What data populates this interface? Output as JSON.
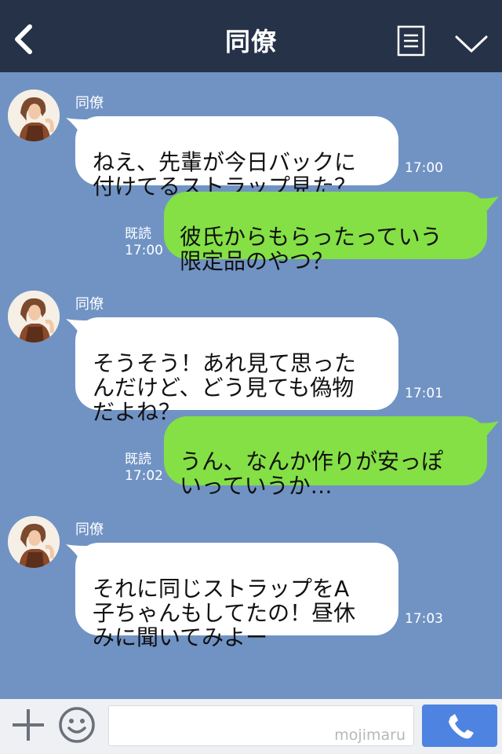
{
  "header": {
    "title": "同僚"
  },
  "messages": [
    {
      "sender": "同僚",
      "text": "ねえ、先輩が今日バックに\n付けてるストラップ見た？",
      "time": "17:00"
    },
    {
      "read": "既読",
      "text": "彼氏からもらったっていう\n限定品のやつ？",
      "time": "17:00"
    },
    {
      "sender": "同僚",
      "text": "そうそう！あれ見て思った\nんだけど、どう見ても偽物\nだよね？",
      "time": "17:01"
    },
    {
      "read": "既読",
      "text": "うん、なんか作りが安っぽ\nいっていうか…",
      "time": "17:02"
    },
    {
      "sender": "同僚",
      "text": "それに同じストラップをA\n子ちゃんもしてたの！昼休\nみに聞いてみよー",
      "time": "17:03"
    }
  ],
  "footer": {
    "watermark": "mojimaru"
  },
  "colors": {
    "header": "#263247",
    "background": "#7093c4",
    "outgoing": "#84e045",
    "incoming": "#ffffff",
    "call": "#4f83e1"
  },
  "icons": [
    "back-icon",
    "menu-icon",
    "chevron-down-icon",
    "plus-icon",
    "smiley-icon",
    "phone-icon"
  ]
}
